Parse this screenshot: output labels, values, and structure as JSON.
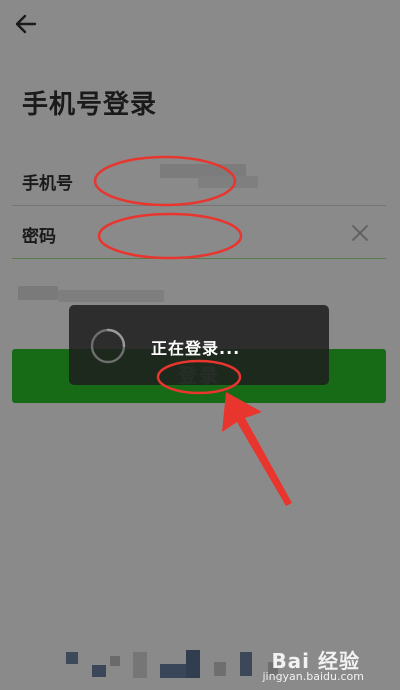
{
  "header": {
    "back_icon": "arrow-left-icon",
    "title": "手机号登录"
  },
  "form": {
    "phone_label": "手机号",
    "phone_value": "",
    "password_label": "密码",
    "password_value": "",
    "clear_icon": "close-icon"
  },
  "login_button": {
    "label": "登录",
    "color": "#176b17"
  },
  "toast": {
    "message": "正在登录...",
    "icon": "spinner-icon"
  },
  "annotations": {
    "color": "#e8352e"
  },
  "watermark": {
    "logo": "Bai 经验",
    "url": "jingyan.baidu.com"
  }
}
